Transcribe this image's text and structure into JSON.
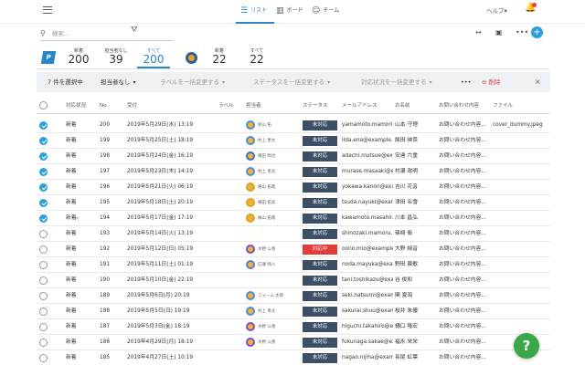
{
  "nav": {
    "tabs": [
      {
        "label": "リスト",
        "icon": "list-icon",
        "active": true
      },
      {
        "label": "ボード",
        "icon": "board-icon",
        "active": false
      },
      {
        "label": "チーム",
        "icon": "team-icon",
        "active": false
      }
    ],
    "help_label": "ヘルプ",
    "help_caret": "▾"
  },
  "search": {
    "placeholder": "検索..."
  },
  "stats": [
    {
      "label": "新着",
      "value": "200"
    },
    {
      "label": "担当者なし",
      "value": "39"
    },
    {
      "label": "すべて",
      "value": "200",
      "active": true
    },
    {
      "label": "新着",
      "value": "22"
    },
    {
      "label": "すべて",
      "value": "22"
    }
  ],
  "logo_letter": "P",
  "bulk": {
    "selected": "7 件を選択中",
    "assignee": "担当者なし",
    "label": "ラベルを一括変更する",
    "status": "ステータスを一括変更する",
    "progress": "対応状況を一括変更する",
    "more": "•••",
    "delete": "削除",
    "close": "×"
  },
  "columns": [
    "対応状況",
    "No.",
    "受付",
    "ラベル",
    "担当者",
    "ステータス",
    "メールアドレス",
    "お名前",
    "お問い合わせ内容",
    "ファイル"
  ],
  "rows": [
    {
      "checked": true,
      "progress": "新着",
      "no": "200",
      "date": "2019年5月29日(水) 13:19",
      "assignee": "秋山 拓",
      "av": "#4a8fd4",
      "status": "未対応",
      "email": "yamamoto.mamori...",
      "name": "山本 守理",
      "inquiry": "お問い合わせ内容...",
      "file": "cover_dummy.jpeg"
    },
    {
      "checked": true,
      "progress": "新着",
      "no": "199",
      "date": "2019年5月25日(土) 18:19",
      "assignee": "村上 恵太",
      "av": "#4a8fd4",
      "status": "未対応",
      "email": "iida.ena@example.c...",
      "name": "飯田 映菜",
      "inquiry": "お問い合わせ内容...",
      "file": ""
    },
    {
      "checked": true,
      "progress": "新着",
      "no": "198",
      "date": "2019年5月24日(金) 16:19",
      "assignee": "横田 剛也",
      "av": "#3a6fc0",
      "status": "未対応",
      "email": "adachi.mutsue@exa...",
      "name": "安達 六重",
      "inquiry": "お問い合わせ内容...",
      "file": ""
    },
    {
      "checked": true,
      "progress": "新着",
      "no": "197",
      "date": "2019年5月23日(木) 14:19",
      "assignee": "村上 恵太",
      "av": "#4a8fd4",
      "status": "未対応",
      "email": "murase.masaaki@ex...",
      "name": "村瀬 政明",
      "inquiry": "お問い合わせ内容...",
      "file": ""
    },
    {
      "checked": true,
      "progress": "新着",
      "no": "196",
      "date": "2019年5月21日(火) 06:19",
      "assignee": "横山 拓哉",
      "av": "#d9a320",
      "status": "未対応",
      "email": "yokawa.kanon@exa...",
      "name": "吉川 花音",
      "inquiry": "お問い合わせ内容...",
      "file": ""
    },
    {
      "checked": true,
      "progress": "新着",
      "no": "195",
      "date": "2019年5月18日(土) 20:19",
      "assignee": "横田 拓実",
      "av": "#d9a320",
      "status": "未対応",
      "email": "tsuda.nayuki@exam...",
      "name": "津田 名雪",
      "inquiry": "お問い合わせ内容...",
      "file": ""
    },
    {
      "checked": true,
      "progress": "新着",
      "no": "194",
      "date": "2019年5月17日(金) 17:19",
      "assignee": "横山 拓哉",
      "av": "#d9a320",
      "status": "未対応",
      "email": "kawamoto.masahir...",
      "name": "川本 昌弘",
      "inquiry": "お問い合わせ内容...",
      "file": ""
    },
    {
      "checked": false,
      "progress": "新着",
      "no": "193",
      "date": "2019年5月14日(火) 13:19",
      "assignee": "",
      "av": "",
      "status": "未対応",
      "email": "shinozaki.mamoru...",
      "name": "篠崎 衛",
      "inquiry": "お問い合わせ内容...",
      "file": ""
    },
    {
      "checked": false,
      "progress": "新着",
      "no": "192",
      "date": "2019年5月12日(日) 05:19",
      "assignee": "水野 公香",
      "av": "#7a4fc4",
      "status": "対応中",
      "red": true,
      "email": "oono.mio@example...",
      "name": "大野 緑音",
      "inquiry": "お問い合わせ内容...",
      "file": ""
    },
    {
      "checked": false,
      "progress": "新着",
      "no": "191",
      "date": "2019年5月11日(土) 01:19",
      "assignee": "広瀬 晴人",
      "av": "#5a7fd0",
      "status": "未対応",
      "email": "noda.mayuka@exam...",
      "name": "野田 繭歌",
      "inquiry": "お問い合わせ内容...",
      "file": ""
    },
    {
      "checked": false,
      "progress": "新着",
      "no": "190",
      "date": "2019年5月10日(金) 22:19",
      "assignee": "",
      "av": "",
      "status": "未対応",
      "email": "tani.toshikazu@exa...",
      "name": "谷 俊和",
      "inquiry": "お問い合わせ内容...",
      "file": ""
    },
    {
      "checked": false,
      "progress": "新着",
      "no": "189",
      "date": "2019年5月6日(月) 20:19",
      "assignee": "フォーム 太郎",
      "av": "#4a8fd4",
      "status": "未対応",
      "email": "seki.natsumi@exampl...",
      "name": "関 夏海",
      "inquiry": "お問い合わせ内容...",
      "file": ""
    },
    {
      "checked": false,
      "progress": "新着",
      "no": "188",
      "date": "2019年5月5日(日) 19:19",
      "assignee": "村上 恵太",
      "av": "#4a8fd4",
      "status": "未対応",
      "email": "sakurai.shuu@exam...",
      "name": "桜井 朱優",
      "inquiry": "お問い合わせ内容...",
      "file": ""
    },
    {
      "checked": false,
      "progress": "新着",
      "no": "187",
      "date": "2019年5月3日(金) 18:19",
      "assignee": "水野 公香",
      "av": "#7a4fc4",
      "status": "未対応",
      "email": "higuchi.takahiro@ex...",
      "name": "樋口 隆宏",
      "inquiry": "お問い合わせ内容...",
      "file": ""
    },
    {
      "checked": false,
      "progress": "新着",
      "no": "186",
      "date": "2019年4月29日(月) 18:19",
      "assignee": "水野 公香",
      "av": "#7a4fc4",
      "status": "未対応",
      "email": "fukunaga.sakae@ex...",
      "name": "福永 栄栄",
      "inquiry": "お問い合わせ内容...",
      "file": ""
    },
    {
      "checked": false,
      "progress": "新着",
      "no": "185",
      "date": "2019年4月27日(土) 10:19",
      "assignee": "",
      "av": "",
      "status": "未対応",
      "email": "nagao.nijiha@exam...",
      "name": "長尾 虹葉",
      "inquiry": "お問い合わせ内容...",
      "file": ""
    }
  ],
  "help_fab": "?"
}
